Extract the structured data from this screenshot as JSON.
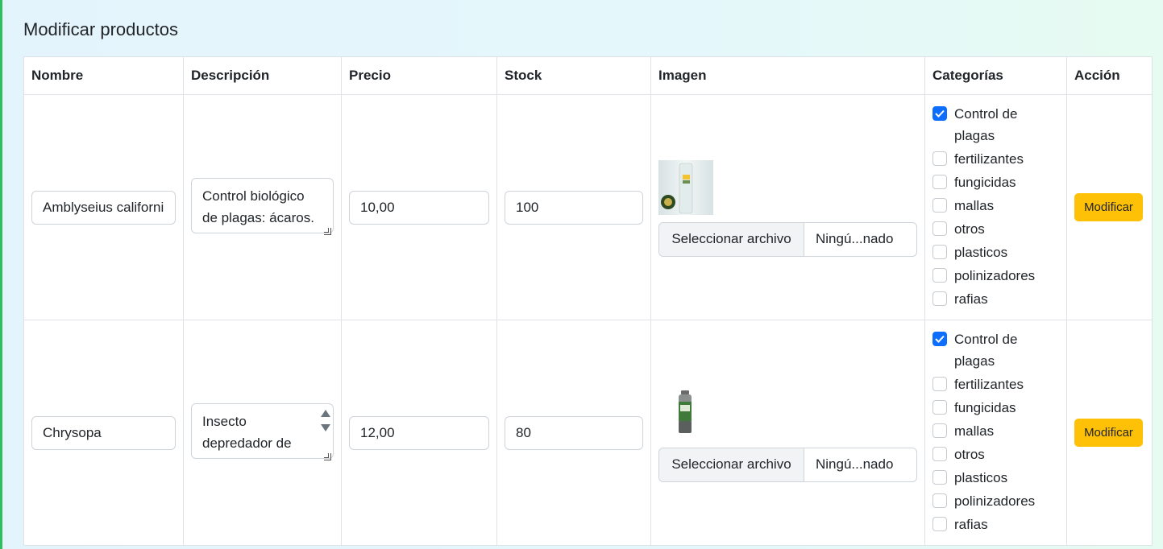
{
  "page": {
    "title": "Modificar productos"
  },
  "table": {
    "columns": [
      "Nombre",
      "Descripción",
      "Precio",
      "Stock",
      "Imagen",
      "Categorías",
      "Acción"
    ],
    "rows": [
      {
        "nombre": "Amblyseius californicus",
        "descripcion": "Control biológico de plagas: ácaros.",
        "precio": "10,00",
        "stock": "100",
        "image_icon": "product-bottle-image",
        "file_button": "Seleccionar archivo",
        "file_name": "Ningú...nado",
        "categories": [
          {
            "label": "Control de plagas",
            "checked": true
          },
          {
            "label": "fertilizantes",
            "checked": false
          },
          {
            "label": "fungicidas",
            "checked": false
          },
          {
            "label": "mallas",
            "checked": false
          },
          {
            "label": "otros",
            "checked": false
          },
          {
            "label": "plasticos",
            "checked": false
          },
          {
            "label": "polinizadores",
            "checked": false
          },
          {
            "label": "rafias",
            "checked": false
          }
        ],
        "action": "Modificar"
      },
      {
        "nombre": "Chrysopa",
        "descripcion": "Insecto depredador de áfidos",
        "precio": "12,00",
        "stock": "80",
        "image_icon": "product-bottle-image",
        "file_button": "Seleccionar archivo",
        "file_name": "Ningú...nado",
        "categories": [
          {
            "label": "Control de plagas",
            "checked": true
          },
          {
            "label": "fertilizantes",
            "checked": false
          },
          {
            "label": "fungicidas",
            "checked": false
          },
          {
            "label": "mallas",
            "checked": false
          },
          {
            "label": "otros",
            "checked": false
          },
          {
            "label": "plasticos",
            "checked": false
          },
          {
            "label": "polinizadores",
            "checked": false
          },
          {
            "label": "rafias",
            "checked": false
          }
        ],
        "action": "Modificar"
      }
    ]
  },
  "colors": {
    "accent_checkbox": "#0d6efd",
    "action_button": "#ffc107",
    "left_border": "#2ec05a"
  }
}
